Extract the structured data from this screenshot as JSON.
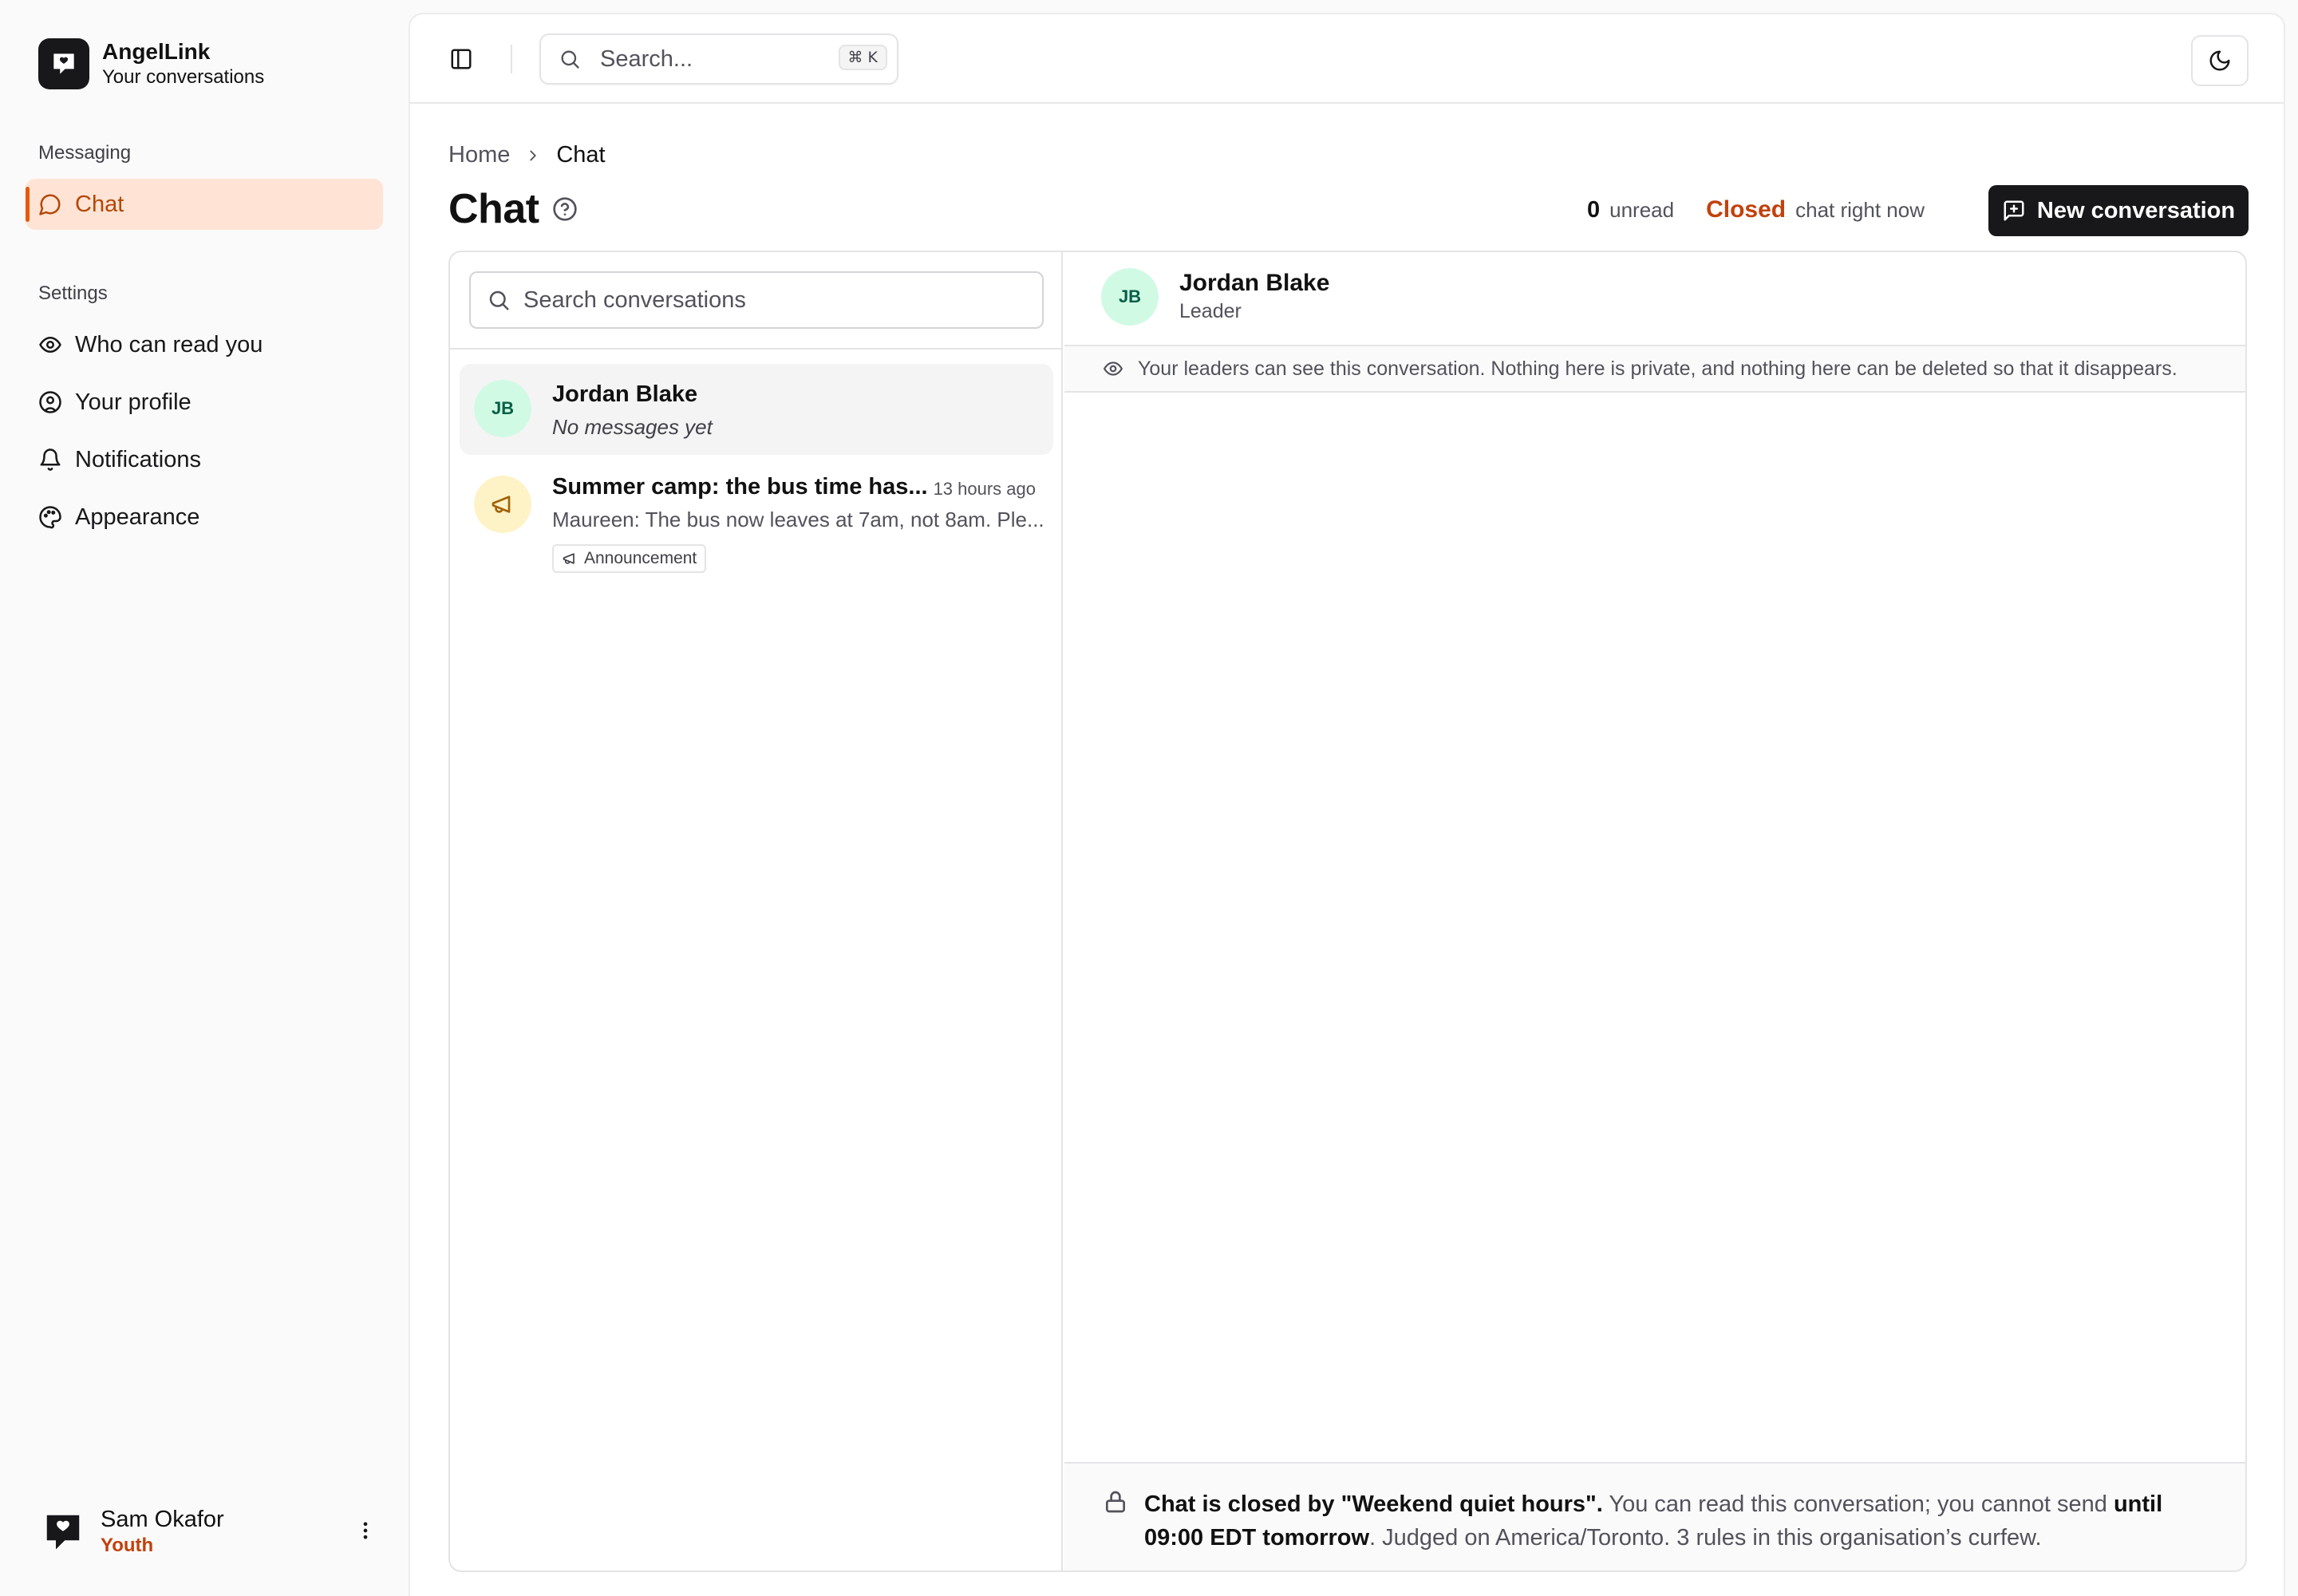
{
  "app": {
    "name": "AngelLink",
    "subtitle": "Your conversations"
  },
  "sidebar": {
    "messaging_label": "Messaging",
    "settings_label": "Settings",
    "items": [
      {
        "label": "Chat",
        "icon": "message-circle-icon",
        "active": true
      },
      {
        "label": "Who can read you",
        "icon": "eye-icon"
      },
      {
        "label": "Your profile",
        "icon": "user-circle-icon"
      },
      {
        "label": "Notifications",
        "icon": "bell-icon"
      },
      {
        "label": "Appearance",
        "icon": "palette-icon"
      }
    ]
  },
  "user": {
    "name": "Sam Okafor",
    "role": "Youth"
  },
  "topbar": {
    "search_placeholder": "Search...",
    "shortcut": "⌘ K"
  },
  "breadcrumb": {
    "home": "Home",
    "current": "Chat"
  },
  "page": {
    "title": "Chat",
    "unread_count": "0",
    "unread_label": "unread",
    "status": "Closed",
    "status_label": "chat right now",
    "new_conversation_label": "New conversation"
  },
  "conversations": {
    "search_placeholder": "Search conversations",
    "items": [
      {
        "initials": "JB",
        "name": "Jordan Blake",
        "preview": "No messages yet",
        "selected": true
      },
      {
        "icon": "megaphone-icon",
        "name": "Summer camp: the bus time has...",
        "time": "13 hours ago",
        "preview": "Maureen: The bus now leaves at 7am, not 8am. Ple...",
        "tag": "Announcement"
      }
    ]
  },
  "thread": {
    "initials": "JB",
    "name": "Jordan Blake",
    "role": "Leader",
    "notice": "Your leaders can see this conversation. Nothing here is private, and nothing here can be deleted so that it disappears.",
    "closed_bold": "Chat is closed by \"Weekend quiet hours\".",
    "closed_text": " You can read this conversation; you cannot send ",
    "closed_until": "until 09:00 EDT tomorrow",
    "closed_tail": ". Judged on America/Toronto. 3 rules in this organisation’s curfew."
  },
  "colors": {
    "accent": "#c2410c",
    "active_bg": "#ffe4d5",
    "primary_button": "#18181b"
  }
}
